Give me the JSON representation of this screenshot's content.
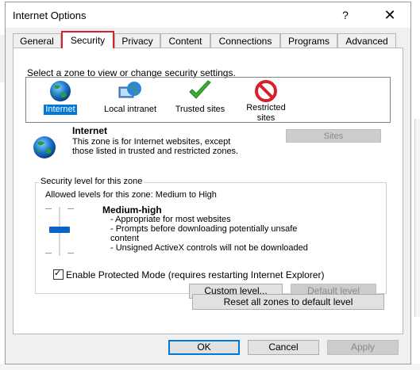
{
  "window": {
    "title": "Internet Options",
    "help": "?",
    "close": "✕"
  },
  "tabs": [
    {
      "label": "General"
    },
    {
      "label": "Security"
    },
    {
      "label": "Privacy"
    },
    {
      "label": "Content"
    },
    {
      "label": "Connections"
    },
    {
      "label": "Programs"
    },
    {
      "label": "Advanced"
    }
  ],
  "zones": {
    "prompt": "Select a zone to view or change security settings.",
    "items": [
      {
        "label": "Internet",
        "icon": "globe-icon"
      },
      {
        "label": "Local intranet",
        "icon": "network-globe-icon"
      },
      {
        "label": "Trusted sites",
        "icon": "checkmark-icon"
      },
      {
        "label": "Restricted sites",
        "icon": "no-entry-icon"
      }
    ]
  },
  "zone_info": {
    "title": "Internet",
    "description": "This zone is for Internet websites, except those listed in trusted and restricted zones.",
    "sites_button": "Sites"
  },
  "security_level": {
    "legend": "Security level for this zone",
    "allowed": "Allowed levels for this zone: Medium to High",
    "level_title": "Medium-high",
    "bullets": [
      "- Appropriate for most websites",
      "- Prompts before downloading potentially unsafe content",
      "- Unsigned ActiveX controls will not be downloaded"
    ],
    "protected_mode": "Enable Protected Mode (requires restarting Internet Explorer)",
    "custom_level": "Custom level...",
    "default_level": "Default level"
  },
  "reset_all": "Reset all zones to default level",
  "footer": {
    "ok": "OK",
    "cancel": "Cancel",
    "apply": "Apply"
  },
  "colors": {
    "accent": "#0078d7",
    "highlight": "#d4232a"
  }
}
